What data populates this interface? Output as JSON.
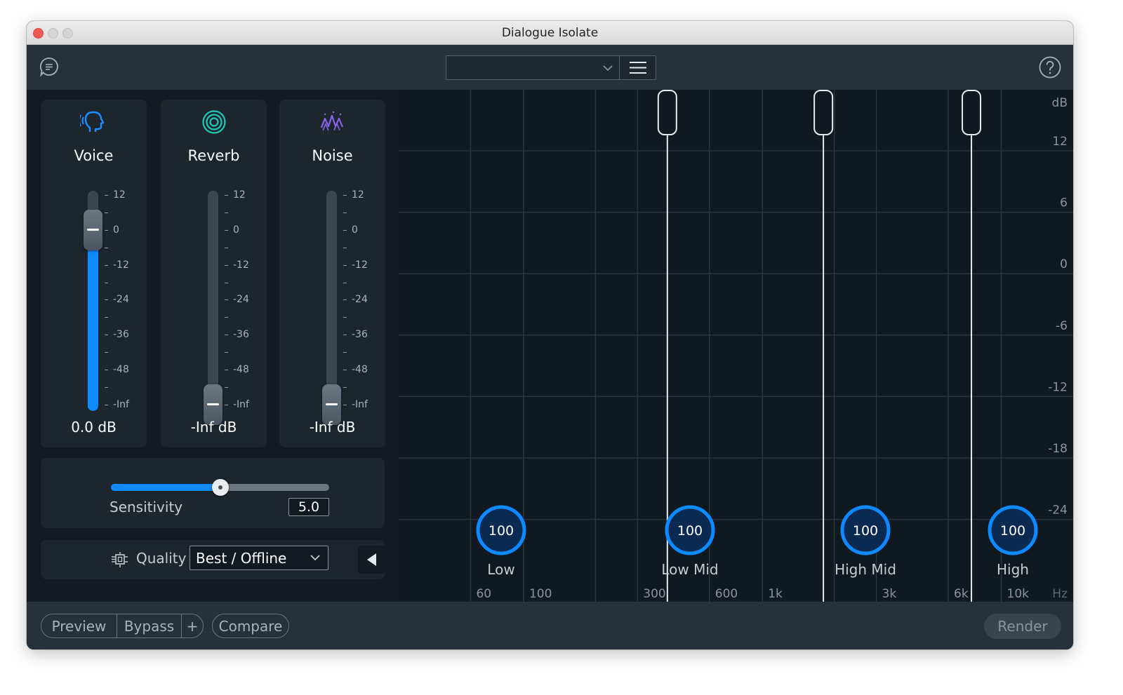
{
  "window": {
    "title": "Dialogue Isolate"
  },
  "toolbar": {
    "preset_value": ""
  },
  "modules": [
    {
      "name": "Voice",
      "value": "0.0 dB",
      "level_db": 0,
      "icon": "voice-head-icon",
      "color": "#1e8cff"
    },
    {
      "name": "Reverb",
      "value": "-Inf dB",
      "level_db": "-Inf",
      "icon": "reverb-rings-icon",
      "color": "#1fc9b7"
    },
    {
      "name": "Noise",
      "value": "-Inf dB",
      "level_db": "-Inf",
      "icon": "noise-waves-icon",
      "color": "#8a63e8"
    }
  ],
  "fader_scale": [
    "12",
    "0",
    "-12",
    "-24",
    "-36",
    "-48",
    "-Inf"
  ],
  "sensitivity": {
    "label": "Sensitivity",
    "value": "5.0",
    "fraction": 0.5
  },
  "quality": {
    "label": "Quality",
    "value": "Best / Offline"
  },
  "eq": {
    "db_unit": "dB",
    "hz_unit": "Hz",
    "db_labels": [
      "12",
      "6",
      "0",
      "-6",
      "-12",
      "-18",
      "-24"
    ],
    "freq_labels": [
      "60",
      "100",
      "300",
      "600",
      "1k",
      "3k",
      "6k",
      "10k"
    ],
    "bands": [
      {
        "name": "Low",
        "value": "100"
      },
      {
        "name": "Low Mid",
        "value": "100"
      },
      {
        "name": "High Mid",
        "value": "100"
      },
      {
        "name": "High",
        "value": "100"
      }
    ],
    "crossovers_hz": [
      400,
      1800,
      7500
    ]
  },
  "bottom": {
    "preview": "Preview",
    "bypass": "Bypass",
    "plus": "+",
    "compare": "Compare",
    "render": "Render"
  },
  "colors": {
    "accent": "#0d8aff",
    "panel": "#1d252d",
    "background": "#131a21"
  }
}
